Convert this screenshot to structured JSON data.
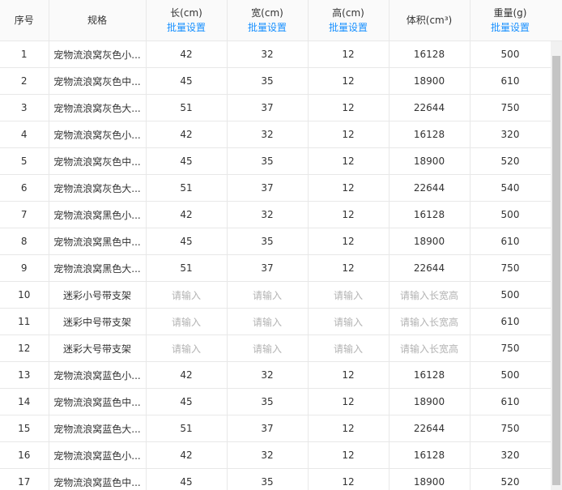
{
  "columns": {
    "seq": "序号",
    "spec": "规格",
    "length": "长(cm)",
    "width": "宽(cm)",
    "height": "高(cm)",
    "volume": "体积(cm³)",
    "weight": "重量(g)",
    "batch_label": "批量设置"
  },
  "rows": [
    {
      "seq": "1",
      "spec": "宠物流浪窝灰色小...",
      "length": "42",
      "width": "32",
      "height": "12",
      "volume": "16128",
      "weight": "500"
    },
    {
      "seq": "2",
      "spec": "宠物流浪窝灰色中...",
      "length": "45",
      "width": "35",
      "height": "12",
      "volume": "18900",
      "weight": "610"
    },
    {
      "seq": "3",
      "spec": "宠物流浪窝灰色大...",
      "length": "51",
      "width": "37",
      "height": "12",
      "volume": "22644",
      "weight": "750"
    },
    {
      "seq": "4",
      "spec": "宠物流浪窝灰色小...",
      "length": "42",
      "width": "32",
      "height": "12",
      "volume": "16128",
      "weight": "320"
    },
    {
      "seq": "5",
      "spec": "宠物流浪窝灰色中...",
      "length": "45",
      "width": "35",
      "height": "12",
      "volume": "18900",
      "weight": "520"
    },
    {
      "seq": "6",
      "spec": "宠物流浪窝灰色大...",
      "length": "51",
      "width": "37",
      "height": "12",
      "volume": "22644",
      "weight": "540"
    },
    {
      "seq": "7",
      "spec": "宠物流浪窝黑色小...",
      "length": "42",
      "width": "32",
      "height": "12",
      "volume": "16128",
      "weight": "500"
    },
    {
      "seq": "8",
      "spec": "宠物流浪窝黑色中...",
      "length": "45",
      "width": "35",
      "height": "12",
      "volume": "18900",
      "weight": "610"
    },
    {
      "seq": "9",
      "spec": "宠物流浪窝黑色大...",
      "length": "51",
      "width": "37",
      "height": "12",
      "volume": "22644",
      "weight": "750"
    },
    {
      "seq": "10",
      "spec": "迷彩小号带支架",
      "length": "请输入",
      "width": "请输入",
      "height": "请输入",
      "volume": "请输入长宽高",
      "weight": "500",
      "placeholder": true
    },
    {
      "seq": "11",
      "spec": "迷彩中号带支架",
      "length": "请输入",
      "width": "请输入",
      "height": "请输入",
      "volume": "请输入长宽高",
      "weight": "610",
      "placeholder": true
    },
    {
      "seq": "12",
      "spec": "迷彩大号带支架",
      "length": "请输入",
      "width": "请输入",
      "height": "请输入",
      "volume": "请输入长宽高",
      "weight": "750",
      "placeholder": true
    },
    {
      "seq": "13",
      "spec": "宠物流浪窝蓝色小...",
      "length": "42",
      "width": "32",
      "height": "12",
      "volume": "16128",
      "weight": "500"
    },
    {
      "seq": "14",
      "spec": "宠物流浪窝蓝色中...",
      "length": "45",
      "width": "35",
      "height": "12",
      "volume": "18900",
      "weight": "610"
    },
    {
      "seq": "15",
      "spec": "宠物流浪窝蓝色大...",
      "length": "51",
      "width": "37",
      "height": "12",
      "volume": "22644",
      "weight": "750"
    },
    {
      "seq": "16",
      "spec": "宠物流浪窝蓝色小...",
      "length": "42",
      "width": "32",
      "height": "12",
      "volume": "16128",
      "weight": "320"
    },
    {
      "seq": "17",
      "spec": "宠物流浪窝蓝色中...",
      "length": "45",
      "width": "35",
      "height": "12",
      "volume": "18900",
      "weight": "520"
    }
  ],
  "colors": {
    "link": "#1890ff",
    "placeholder": "#b3b3b3",
    "border": "#e8e8e8",
    "header_bg": "#fafafa"
  }
}
